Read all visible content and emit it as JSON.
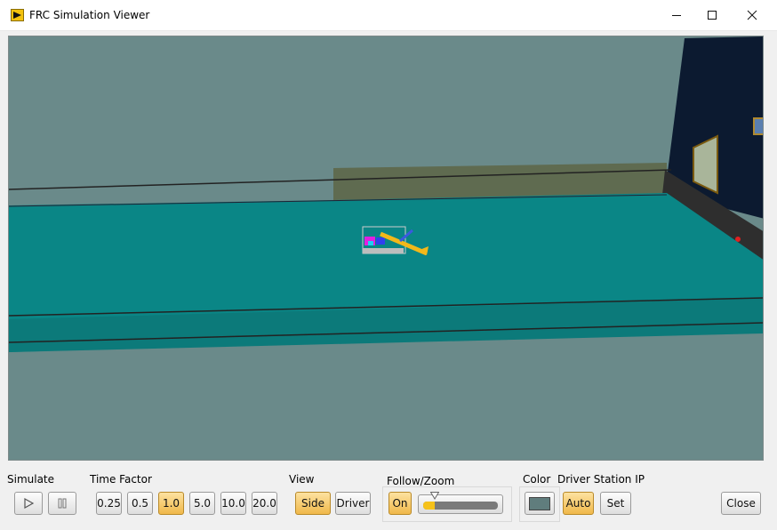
{
  "window": {
    "title": "FRC Simulation Viewer",
    "app_icon": "labview-run-icon",
    "controls": [
      "minimize-icon",
      "maximize-icon",
      "close-icon"
    ]
  },
  "viewport": {
    "scene": "3d-field-view",
    "colors": {
      "background": "#6a8a8a",
      "field_carpet": "#0a8686",
      "field_front": "#0c7a7a",
      "back_wall": "#5f6b50",
      "side_wall": "#0c1a30",
      "robot_accent": "#f2b81a"
    }
  },
  "controls": {
    "simulate": {
      "label": "Simulate",
      "play_icon": "play-icon",
      "pause_icon": "pause-icon"
    },
    "time_factor": {
      "label": "Time Factor",
      "options": [
        "0.25",
        "0.5",
        "1.0",
        "5.0",
        "10.0",
        "20.0"
      ],
      "selected": "1.0"
    },
    "view": {
      "label": "View",
      "options": [
        "Side",
        "Driver"
      ],
      "selected": "Side"
    },
    "follow_zoom": {
      "label": "Follow/Zoom",
      "toggle_label": "On",
      "zoom_level": 0.15
    },
    "color": {
      "label": "Color",
      "swatch": "#607d7d"
    },
    "driver_station_ip": {
      "label": "Driver Station IP",
      "auto_label": "Auto",
      "set_label": "Set"
    },
    "close_label": "Close"
  }
}
